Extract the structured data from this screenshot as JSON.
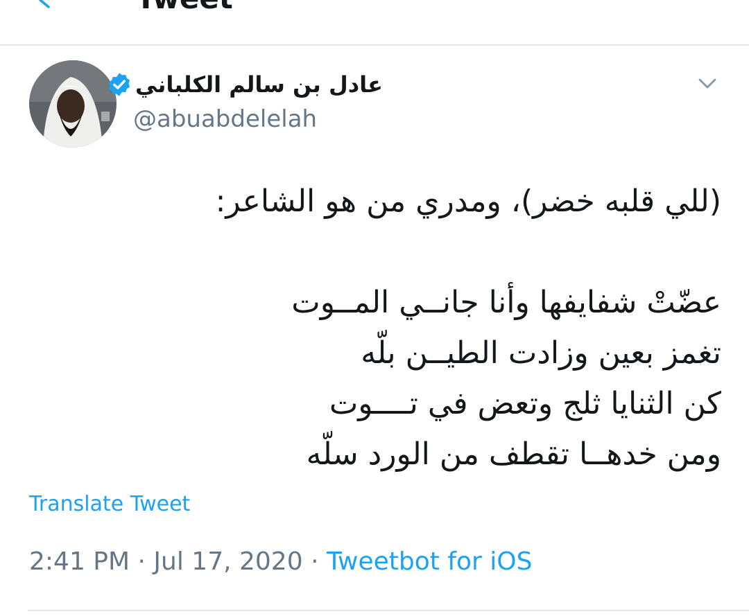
{
  "header": {
    "title": "Tweet"
  },
  "tweet": {
    "author": {
      "display_name": "عادل بن سالم الكلباني",
      "handle": "@abuabdelelah",
      "verified": true
    },
    "text_lines": [
      "(للي قلبه خضر)، ومدري من هو الشاعر:",
      "",
      "عضّتْ شفايفها وأنا جانــي المــوت",
      "تغمز بعين  وزادت الطيــن بلّه",
      "كن الثنايا ثلج  وتعض في تــــوت",
      "ومن خدهــا تقطف من الورد سلّه"
    ],
    "translate_label": "Translate Tweet",
    "time": "2:41 PM",
    "date": "Jul 17, 2020",
    "separator": "·",
    "source": "Tweetbot for iOS"
  },
  "icons": {
    "back": "chevron-left-icon",
    "verified": "verified-badge-icon",
    "menu": "chevron-down-icon"
  },
  "colors": {
    "accent": "#1da1f2",
    "text_primary": "#14171a",
    "text_secondary": "#657786",
    "divider": "#e1e8ed"
  }
}
